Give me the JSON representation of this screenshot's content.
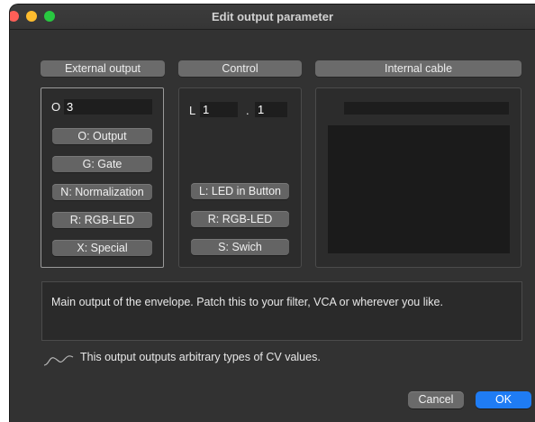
{
  "window": {
    "title": "Edit output parameter"
  },
  "sections": {
    "external": "External output",
    "control": "Control",
    "internal": "Internal cable"
  },
  "external": {
    "prefix": "O",
    "value": "3",
    "buttons": [
      "O: Output",
      "G: Gate",
      "N: Normalization",
      "R: RGB-LED",
      "X: Special"
    ]
  },
  "control": {
    "prefix": "L",
    "value1": "1",
    "separator": ".",
    "value2": "1",
    "buttons": [
      "L: LED in Button",
      "R: RGB-LED",
      "S: Swich"
    ]
  },
  "description": "Main output of the envelope. Patch this to your filter, VCA or wherever you like.",
  "cv_info": {
    "icon": "cv-wave-icon",
    "text": "This output outputs arbitrary types of CV values."
  },
  "footer": {
    "cancel": "Cancel",
    "ok": "OK"
  },
  "colors": {
    "accent": "#1f7cf4",
    "window_bg": "#323232"
  }
}
